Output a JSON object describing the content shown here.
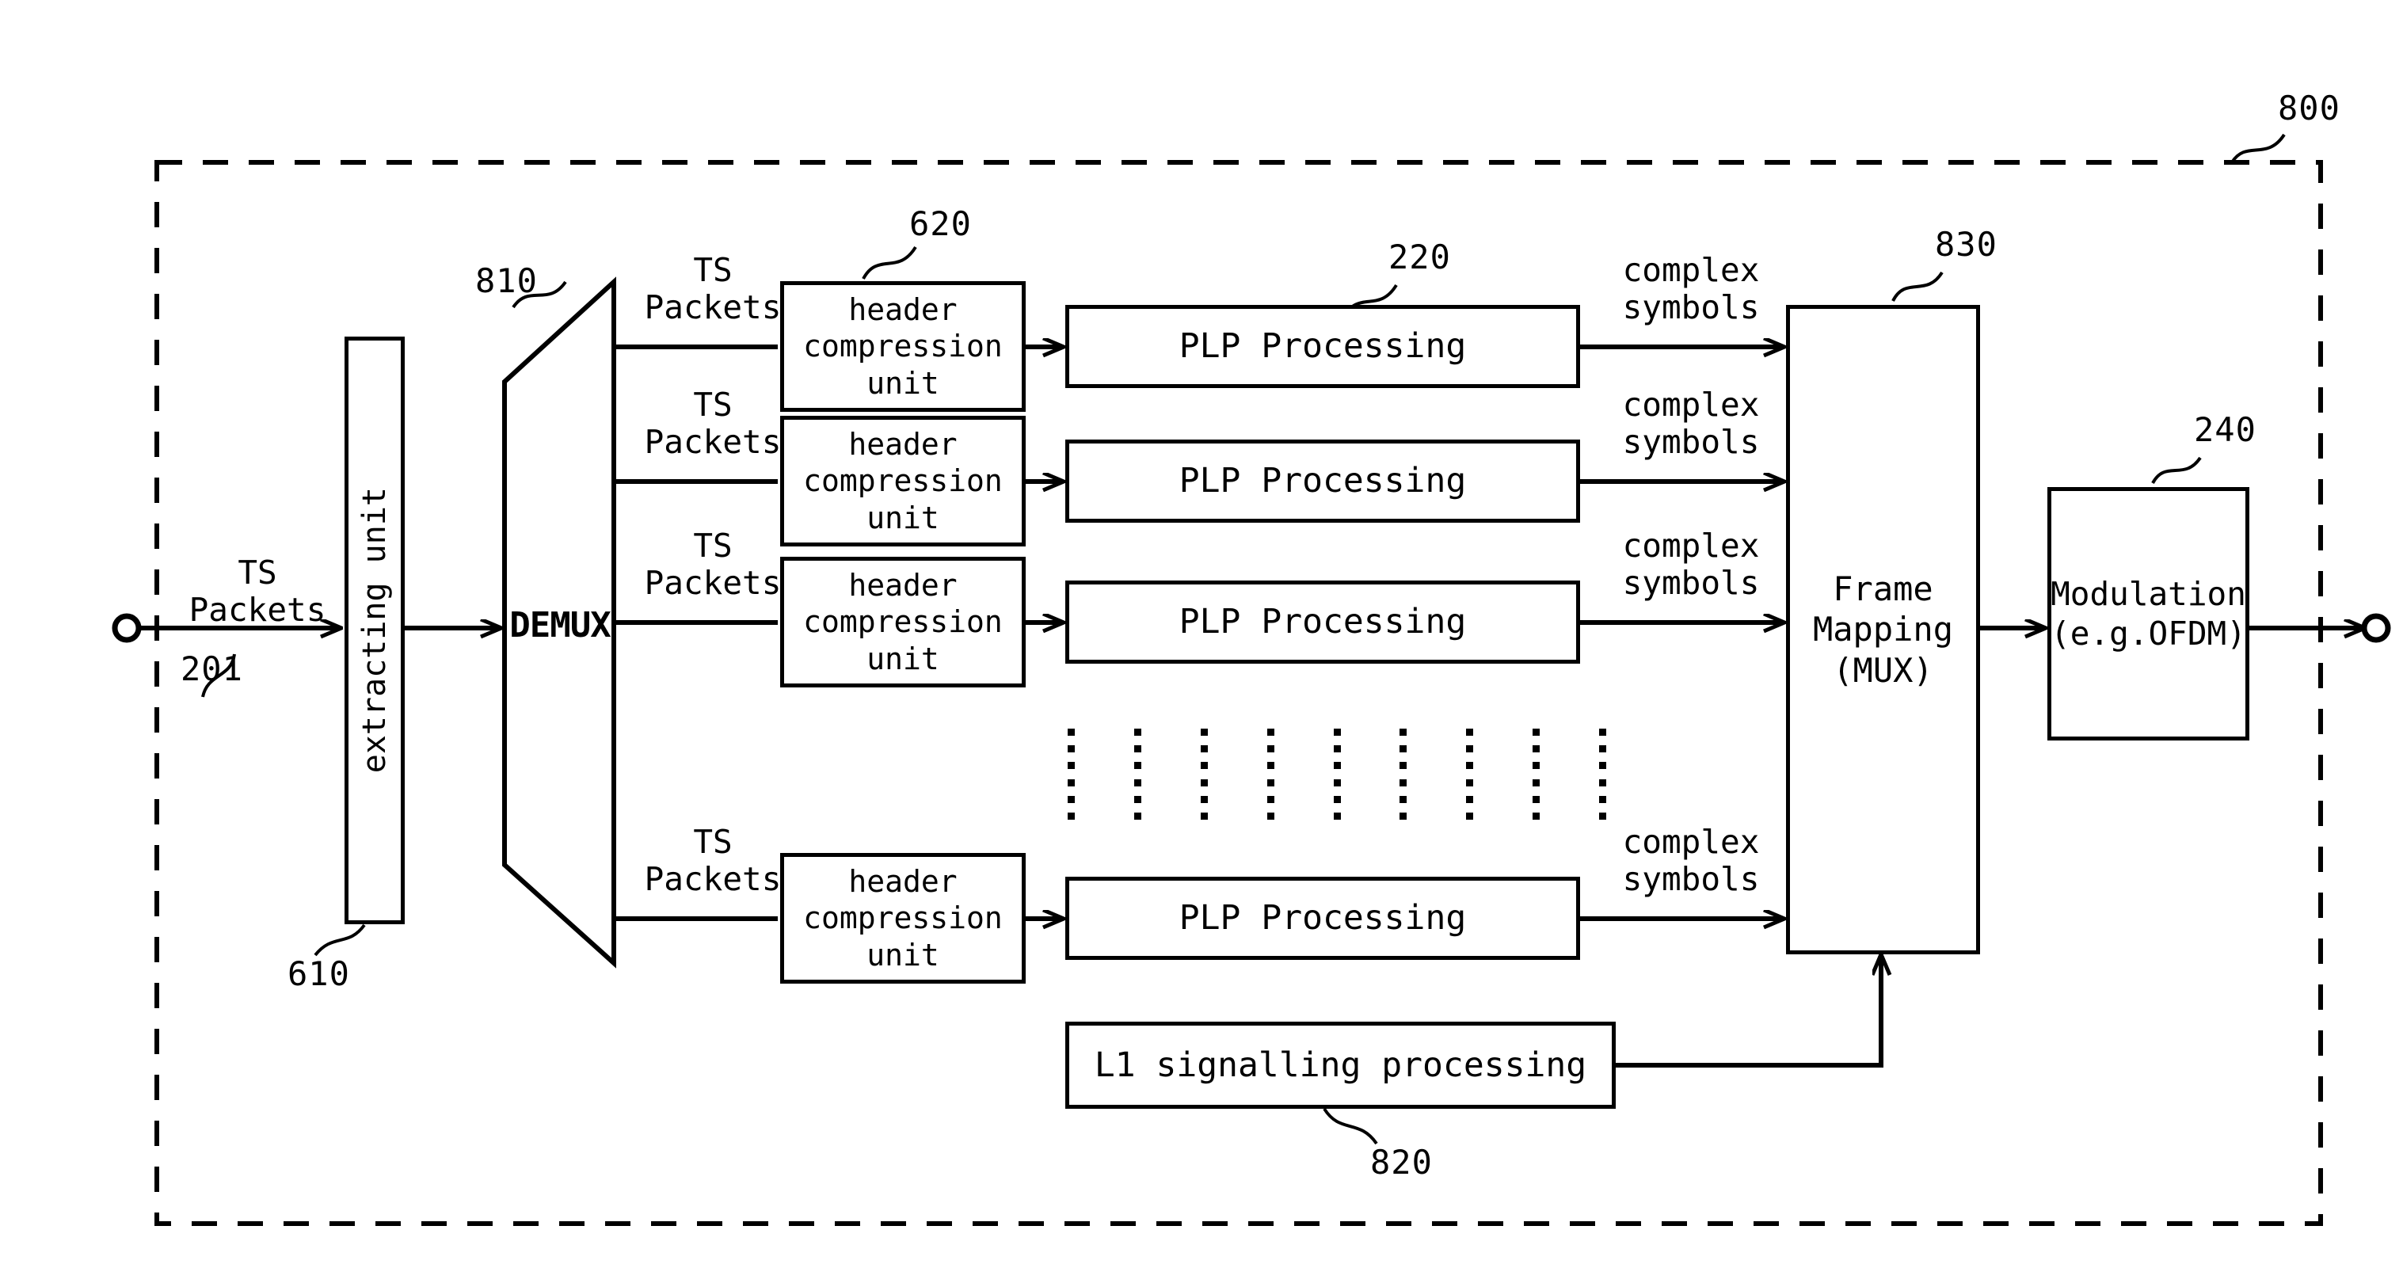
{
  "figure": {
    "frame_ref": "800",
    "input_terminal": "input-terminal",
    "output_terminal": "output-terminal"
  },
  "input": {
    "label": "TS\nPackets",
    "ref": "201"
  },
  "extracting_unit": {
    "label": "extracting unit",
    "ref": "610"
  },
  "demux": {
    "label": "DEMUX",
    "ref": "810"
  },
  "branch_input_label": "TS\nPackets",
  "header_compression": {
    "label": "header\ncompression\nunit",
    "ref": "620"
  },
  "plp": {
    "label": "PLP Processing",
    "ref": "220"
  },
  "complex_symbols_label": "complex\nsymbols",
  "frame_mapping": {
    "label": "Frame\nMapping\n(MUX)",
    "ref": "830"
  },
  "modulation": {
    "label": "Modulation\n(e.g.OFDM)",
    "ref": "240"
  },
  "l1": {
    "label": "L1 signalling processing",
    "ref": "820"
  },
  "branches": [
    {
      "ts_label": "TS\nPackets",
      "hc_label": "header\ncompression\nunit",
      "plp_label": "PLP Processing",
      "cs_label": "complex\nsymbols"
    },
    {
      "ts_label": "TS\nPackets",
      "hc_label": "header\ncompression\nunit",
      "plp_label": "PLP Processing",
      "cs_label": "complex\nsymbols"
    },
    {
      "ts_label": "TS\nPackets",
      "hc_label": "header\ncompression\nunit",
      "plp_label": "PLP Processing",
      "cs_label": "complex\nsymbols"
    },
    {
      "ts_label": "TS\nPackets",
      "hc_label": "header\ncompression\nunit",
      "plp_label": "PLP Processing",
      "cs_label": "complex\nsymbols"
    }
  ],
  "ellipsis": {
    "columns": 9,
    "rows": 6
  },
  "colors": {
    "line": "#000000",
    "background": "#ffffff"
  }
}
